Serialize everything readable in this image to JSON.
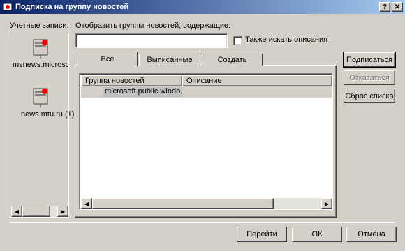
{
  "window": {
    "title": "Подписка на группу новостей",
    "help_label": "?",
    "close_label": "✕"
  },
  "accounts": {
    "label": "Учетные записи:",
    "items": [
      {
        "label": "msnews.microsoft.",
        "icon": "news-server-icon"
      },
      {
        "label": "news.mtu.ru (1)",
        "icon": "news-server-icon"
      }
    ]
  },
  "filter": {
    "label": "Отобразить группы новостей, содержащие:",
    "value": "",
    "checkbox_label": "Также искать описания",
    "checkbox_checked": false
  },
  "tabs": [
    {
      "label": "Все"
    },
    {
      "label": "Выписанные"
    },
    {
      "label": "Создать"
    }
  ],
  "table": {
    "columns": [
      "Группа новостей",
      "Описание"
    ],
    "rows": [
      {
        "group": "microsoft.public.windo...",
        "description": ""
      }
    ]
  },
  "side_buttons": {
    "subscribe": "Подписаться",
    "unsubscribe": "Отказаться",
    "reset": "Сброс списка"
  },
  "footer": {
    "goto": "Перейти",
    "ok": "ОК",
    "cancel": "Отмена"
  }
}
